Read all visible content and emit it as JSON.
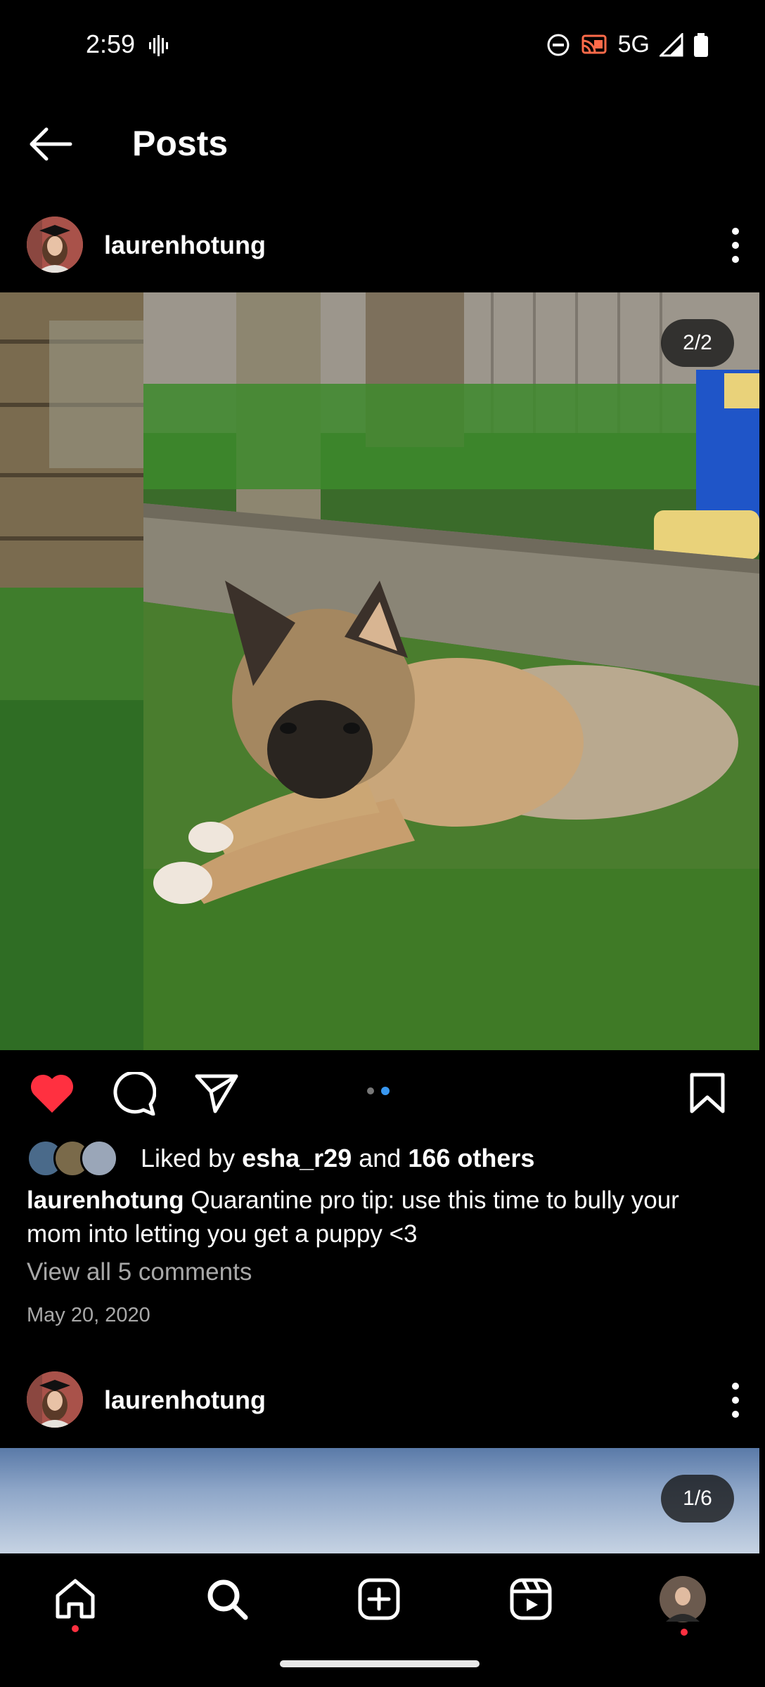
{
  "status": {
    "time": "2:59",
    "network": "5G",
    "icons": [
      "vibrate-icon",
      "dnd-icon",
      "cast-icon",
      "signal-icon",
      "battery-icon"
    ]
  },
  "header": {
    "title": "Posts"
  },
  "post1": {
    "username": "laurenhotung",
    "counter": "2/2",
    "liked_by_prefix": "Liked by ",
    "liked_by_user": "esha_r29",
    "liked_by_and": " and ",
    "liked_by_others": "166 others",
    "caption_user": "laurenhotung",
    "caption_text": " Quarantine pro tip: use this time to bully your mom into letting you get a puppy <3",
    "view_comments": "View all 5 comments",
    "date": "May 20, 2020",
    "liked": true,
    "carousel_index": 2,
    "carousel_total": 2
  },
  "post2": {
    "username": "laurenhotung",
    "counter": "1/6"
  },
  "colors": {
    "like": "#ff3040",
    "dot_active": "#3897f0",
    "background": "#000000"
  }
}
